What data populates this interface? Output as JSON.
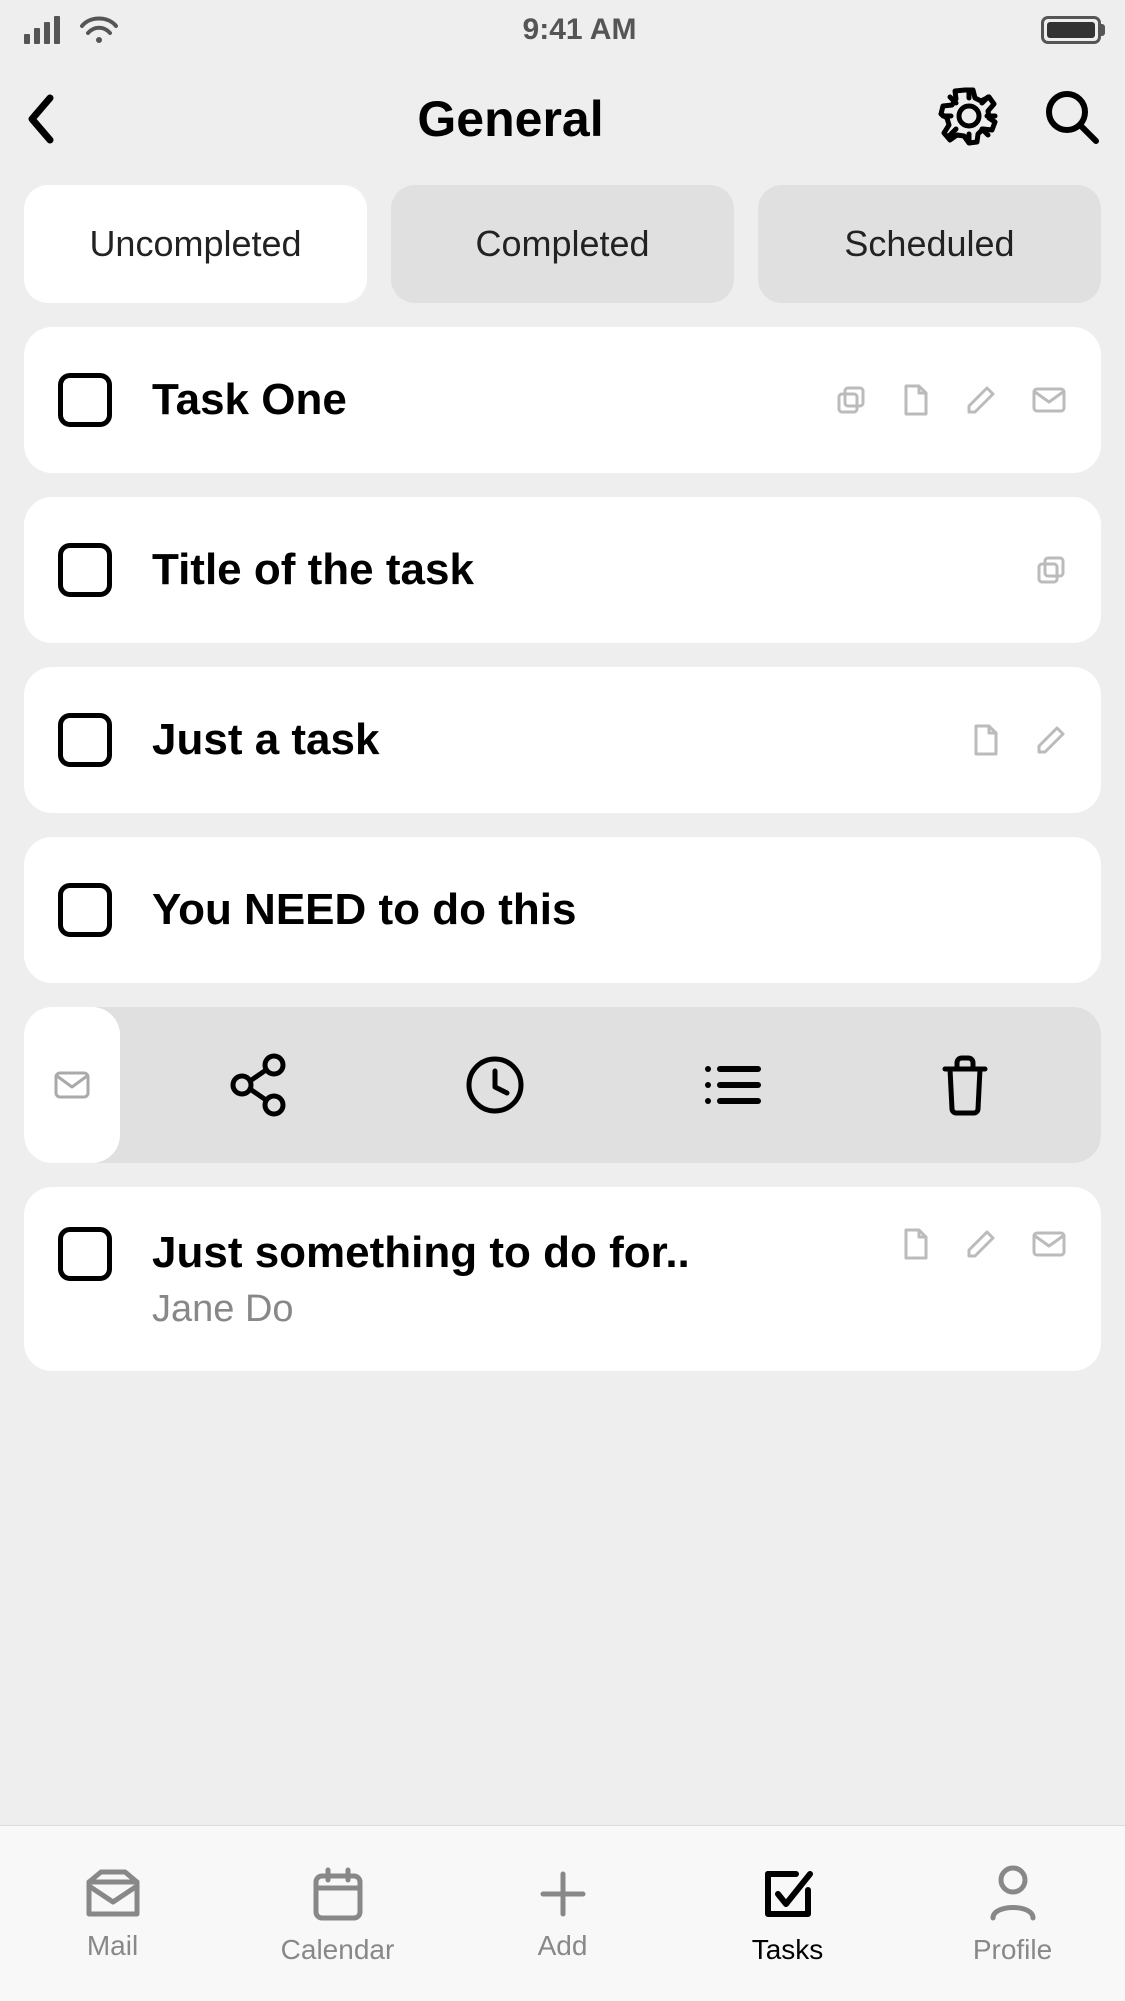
{
  "status": {
    "time": "9:41 AM"
  },
  "header": {
    "title": "General"
  },
  "tabs": {
    "uncompleted": "Uncompleted",
    "completed": "Completed",
    "scheduled": "Scheduled"
  },
  "tasks": [
    {
      "title": "Task One"
    },
    {
      "title": "Title of the task"
    },
    {
      "title": "Just a task"
    },
    {
      "title": "You NEED to do this"
    },
    {
      "title": "Just something to do for..",
      "assignee": "Jane Do"
    }
  ],
  "nav": {
    "mail": "Mail",
    "calendar": "Calendar",
    "add": "Add",
    "tasks": "Tasks",
    "profile": "Profile"
  }
}
